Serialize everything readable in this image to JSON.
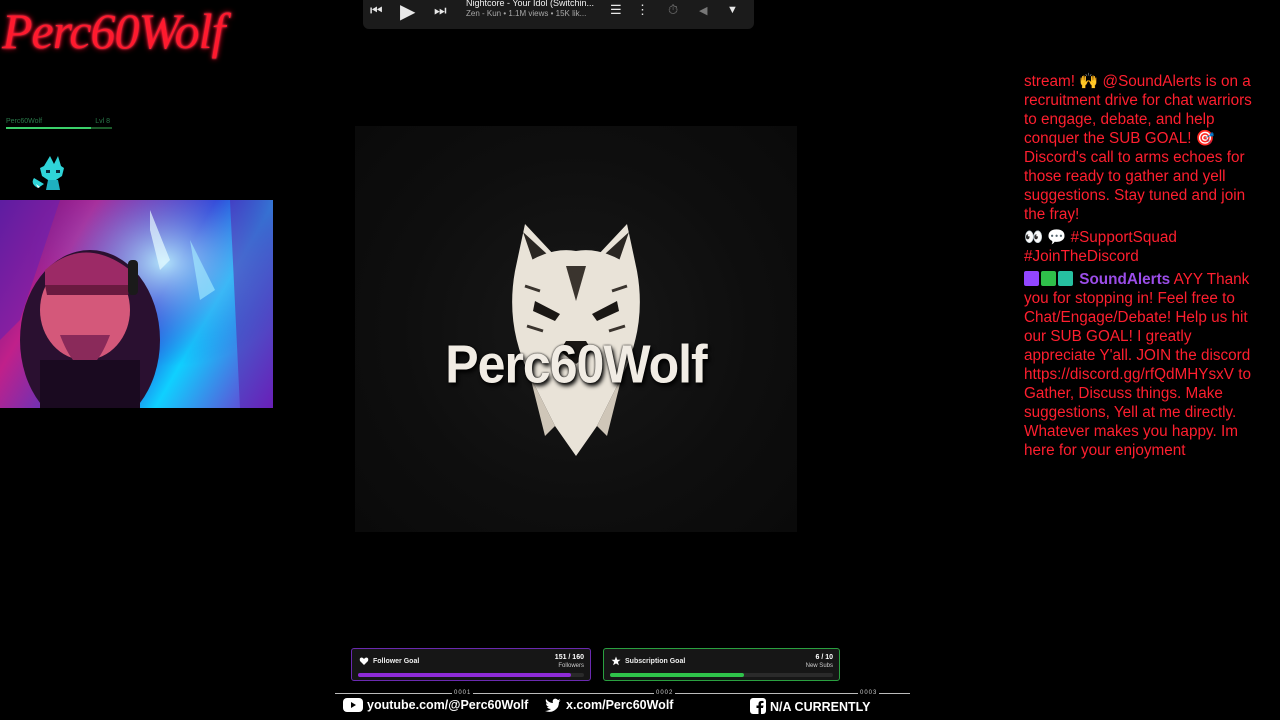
{
  "overlay": {
    "logo_title": "Perc60Wolf",
    "mini_status": {
      "label": "Perc60Wolf",
      "value": "Lvl 8"
    }
  },
  "player": {
    "track_title": "Nightcore - Your Idol (Switchin...",
    "track_subtitle": "Zen - Kun • 1.1M views • 15K lik..."
  },
  "center": {
    "brand_text": "Perc60Wolf"
  },
  "chat": {
    "msg1": "stream! 🙌 @SoundAlerts is on a recruitment drive for chat warriors to engage, debate, and help conquer the SUB GOAL! 🎯 Discord's call to arms echoes for those ready to gather and yell suggestions. Stay tuned and join the fray!",
    "msg2": "👀 💬 #SupportSquad #JoinTheDiscord",
    "msg3_author": "SoundAlerts",
    "msg3_text": "AYY Thank you for stopping in! Feel free to Chat/Engage/Debate! Help us hit our SUB GOAL! I greatly appreciate Y'all. JOIN the discord https://discord.gg/rfQdMHYsxV to Gather, Discuss things. Make suggestions, Yell at me directly. Whatever makes you happy. Im here for your enjoyment"
  },
  "goals": {
    "follower": {
      "name": "Follower Goal",
      "count": "151 / 160",
      "unit": "Followers",
      "progress": 0.944,
      "color": "#8e2bd6"
    },
    "subscription": {
      "name": "Subscription Goal",
      "count": "6 / 10",
      "unit": "New Subs",
      "progress": 0.6,
      "color": "#2fc24a"
    }
  },
  "socials": {
    "youtube": "youtube.com/@Perc60Wolf",
    "x": "x.com/Perc60Wolf",
    "facebook": "N/A CURRENTLY",
    "sep1": "0001",
    "sep2": "0002",
    "sep3": "0003"
  },
  "colors": {
    "chat_text": "#ff1f2f",
    "author": "#9b4de8",
    "logo": "#ff1a2e"
  }
}
